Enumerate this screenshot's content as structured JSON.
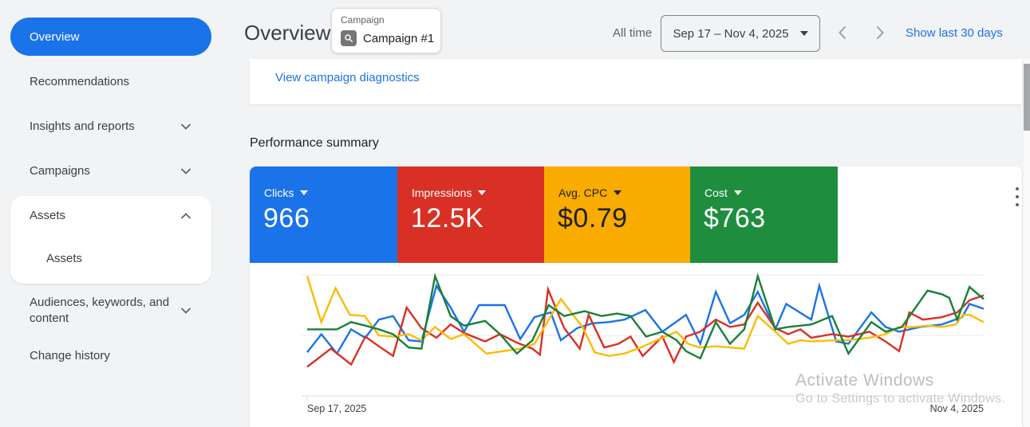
{
  "colors": {
    "accent": "#1a73e8",
    "link": "#1a73e8",
    "page_background": "#f1f3f4"
  },
  "sidebar": {
    "items": [
      {
        "label": "Overview",
        "selected": true
      },
      {
        "label": "Recommendations"
      },
      {
        "label": "Insights and reports",
        "chevron": "chevron-down-icon"
      },
      {
        "label": "Campaigns",
        "chevron": "chevron-down-icon"
      },
      {
        "label": "Assets",
        "chevron": "chevron-up-icon",
        "expanded": true,
        "children": [
          {
            "label": "Assets"
          }
        ]
      },
      {
        "label": "Audiences, keywords, and content",
        "chevron": "chevron-down-icon"
      },
      {
        "label": "Change history"
      }
    ]
  },
  "header": {
    "title": "Overview",
    "campaign_selector": {
      "label": "Campaign",
      "value": "Campaign #1",
      "icon": "magnifier-icon"
    },
    "time_range_label": "All time",
    "date_range": "Sep 17 – Nov 4, 2025",
    "date_nav": {
      "prev_icon": "chevron-left-icon",
      "next_icon": "chevron-right-icon"
    },
    "show_last_link": "Show last 30 days"
  },
  "diagnostics_link": "View campaign diagnostics",
  "section_title": "Performance summary",
  "overflow_menu_icon": "kebab-menu-icon",
  "metrics": [
    {
      "label": "Clicks",
      "value": "966",
      "color": "#1a73e8",
      "text_color": "#ffffff"
    },
    {
      "label": "Impressions",
      "value": "12.5K",
      "color": "#d93025",
      "text_color": "#ffffff"
    },
    {
      "label": "Avg. CPC",
      "value": "$0.79",
      "color": "#f9ab00",
      "text_color": "#202124"
    },
    {
      "label": "Cost",
      "value": "$763",
      "color": "#1e8e3e",
      "text_color": "#ffffff"
    }
  ],
  "chart_data": {
    "type": "line",
    "title": "Performance summary",
    "x_axis": {
      "start_label": "Sep 17, 2025",
      "end_label": "Nov 4, 2025",
      "unit": "day"
    },
    "y_axis": {
      "tick_labels_visible": false,
      "scale": "relative 0-100 of plot height (no numeric ticks shown)"
    },
    "grid": "3 horizontal gridlines (top, middle, baseline)",
    "legend_position": "none (colors match metric tiles)",
    "series": [
      {
        "name": "Clicks",
        "color": "#1a73e8",
        "points": [
          [
            0,
            36
          ],
          [
            2.1,
            51
          ],
          [
            4.4,
            35
          ],
          [
            6.5,
            55
          ],
          [
            8.6,
            48
          ],
          [
            10.6,
            63
          ],
          [
            12.7,
            66
          ],
          [
            15,
            46
          ],
          [
            16.9,
            45
          ],
          [
            19.1,
            91
          ],
          [
            21.2,
            73
          ],
          [
            23.2,
            53
          ],
          [
            25.4,
            75
          ],
          [
            29.2,
            75
          ],
          [
            31.5,
            47
          ],
          [
            33.6,
            65
          ],
          [
            36,
            69
          ],
          [
            37.5,
            46
          ],
          [
            39.9,
            56
          ],
          [
            42.2,
            60
          ],
          [
            44.6,
            61
          ],
          [
            46.9,
            63
          ],
          [
            50,
            71
          ],
          [
            52.5,
            53
          ],
          [
            56,
            67
          ],
          [
            58.1,
            43
          ],
          [
            60.4,
            86
          ],
          [
            62.5,
            60
          ],
          [
            64.6,
            67
          ],
          [
            66.6,
            86
          ],
          [
            69.2,
            55
          ],
          [
            70.8,
            76
          ],
          [
            74.5,
            63
          ],
          [
            75.7,
            91
          ],
          [
            78.2,
            45
          ],
          [
            80,
            43
          ],
          [
            83.4,
            69
          ],
          [
            85.5,
            57
          ],
          [
            87.5,
            53
          ],
          [
            90.6,
            57
          ],
          [
            93.8,
            59
          ],
          [
            96.8,
            65
          ],
          [
            97.9,
            76
          ],
          [
            100,
            72
          ]
        ]
      },
      {
        "name": "Impressions",
        "color": "#d93025",
        "points": [
          [
            0,
            24
          ],
          [
            2.1,
            33
          ],
          [
            3.5,
            39
          ],
          [
            6.5,
            26
          ],
          [
            8.6,
            49
          ],
          [
            10.6,
            41
          ],
          [
            12.7,
            33
          ],
          [
            14.7,
            73
          ],
          [
            16.9,
            56
          ],
          [
            19.1,
            48
          ],
          [
            21.2,
            59
          ],
          [
            23.2,
            52
          ],
          [
            26.3,
            45
          ],
          [
            28.5,
            51
          ],
          [
            31,
            44
          ],
          [
            33.3,
            39
          ],
          [
            34.4,
            34
          ],
          [
            35.6,
            88
          ],
          [
            38,
            56
          ],
          [
            40.3,
            39
          ],
          [
            41.6,
            67
          ],
          [
            43.9,
            40
          ],
          [
            46,
            43
          ],
          [
            47.8,
            49
          ],
          [
            49.6,
            33
          ],
          [
            52.5,
            49
          ],
          [
            54.2,
            28
          ],
          [
            56,
            49
          ],
          [
            58.1,
            53
          ],
          [
            60.4,
            63
          ],
          [
            62.5,
            57
          ],
          [
            64.6,
            59
          ],
          [
            66.6,
            77
          ],
          [
            69.2,
            56
          ],
          [
            71.1,
            51
          ],
          [
            72.9,
            55
          ],
          [
            74.5,
            48
          ],
          [
            77.6,
            51
          ],
          [
            80,
            49
          ],
          [
            83.1,
            53
          ],
          [
            85.5,
            45
          ],
          [
            87.5,
            37
          ],
          [
            89,
            69
          ],
          [
            91,
            63
          ],
          [
            93.8,
            65
          ],
          [
            96.1,
            69
          ],
          [
            97.9,
            79
          ],
          [
            100,
            83
          ]
        ]
      },
      {
        "name": "Avg. CPC",
        "color": "#fbbc04",
        "points": [
          [
            0,
            99
          ],
          [
            2.1,
            61
          ],
          [
            4.2,
            89
          ],
          [
            6.3,
            67
          ],
          [
            8.5,
            66
          ],
          [
            10.6,
            50
          ],
          [
            12.7,
            49
          ],
          [
            15,
            51
          ],
          [
            16.9,
            46
          ],
          [
            18.9,
            57
          ],
          [
            21.2,
            47
          ],
          [
            23.2,
            51
          ],
          [
            26.5,
            35
          ],
          [
            31.5,
            39
          ],
          [
            33.6,
            43
          ],
          [
            37.5,
            80
          ],
          [
            40.7,
            57
          ],
          [
            42.5,
            36
          ],
          [
            44.6,
            33
          ],
          [
            46.9,
            35
          ],
          [
            49.3,
            40
          ],
          [
            52.5,
            48
          ],
          [
            54.6,
            53
          ],
          [
            56.3,
            43
          ],
          [
            58.1,
            40
          ],
          [
            60.4,
            41
          ],
          [
            62.5,
            40
          ],
          [
            64.6,
            39
          ],
          [
            66.6,
            66
          ],
          [
            69.2,
            53
          ],
          [
            71.1,
            43
          ],
          [
            72.9,
            46
          ],
          [
            74.5,
            45
          ],
          [
            78.2,
            46
          ],
          [
            80,
            46
          ],
          [
            83.1,
            48
          ],
          [
            85.5,
            51
          ],
          [
            87.5,
            57
          ],
          [
            89.6,
            57
          ],
          [
            91.8,
            58
          ],
          [
            93.8,
            57
          ],
          [
            95.9,
            59
          ],
          [
            96.9,
            67
          ],
          [
            97.9,
            67
          ],
          [
            100,
            61
          ]
        ]
      },
      {
        "name": "Cost",
        "color": "#188038",
        "points": [
          [
            0,
            55
          ],
          [
            2.1,
            55
          ],
          [
            4.4,
            55
          ],
          [
            6.5,
            61
          ],
          [
            8.6,
            58
          ],
          [
            10.6,
            55
          ],
          [
            12.7,
            51
          ],
          [
            15,
            40
          ],
          [
            16.9,
            39
          ],
          [
            18.9,
            99
          ],
          [
            21.2,
            66
          ],
          [
            23.2,
            58
          ],
          [
            26.3,
            62
          ],
          [
            28.5,
            51
          ],
          [
            31,
            35
          ],
          [
            33.3,
            46
          ],
          [
            35.7,
            75
          ],
          [
            38,
            66
          ],
          [
            41,
            70
          ],
          [
            43.5,
            66
          ],
          [
            45.8,
            68
          ],
          [
            47.8,
            66
          ],
          [
            50.1,
            49
          ],
          [
            52.5,
            53
          ],
          [
            54.6,
            46
          ],
          [
            56,
            37
          ],
          [
            58.1,
            31
          ],
          [
            60.4,
            61
          ],
          [
            62.5,
            43
          ],
          [
            64.6,
            55
          ],
          [
            66.6,
            99
          ],
          [
            69.2,
            55
          ],
          [
            71.1,
            57
          ],
          [
            72.9,
            58
          ],
          [
            74.5,
            59
          ],
          [
            77.6,
            66
          ],
          [
            80,
            35
          ],
          [
            83.4,
            61
          ],
          [
            85.5,
            53
          ],
          [
            87.9,
            57
          ],
          [
            91.7,
            87
          ],
          [
            93.8,
            84
          ],
          [
            94.9,
            81
          ],
          [
            96.1,
            63
          ],
          [
            97.9,
            90
          ],
          [
            100,
            80
          ]
        ]
      }
    ]
  },
  "watermark": {
    "line1": "Activate Windows",
    "line2": "Go to Settings to activate Windows."
  }
}
